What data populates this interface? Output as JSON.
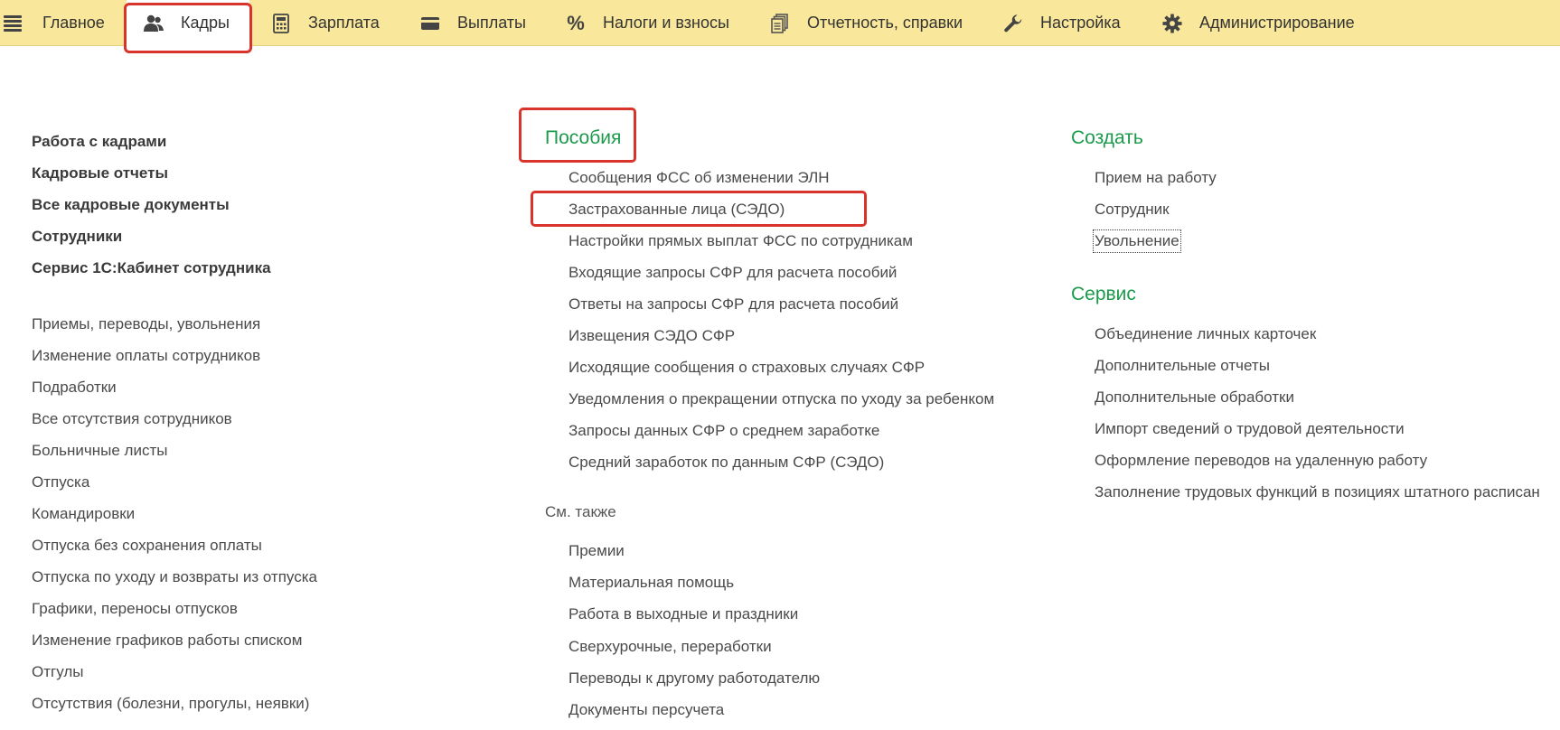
{
  "topbar": {
    "tabs": [
      {
        "label": "Главное",
        "icon": "none"
      },
      {
        "label": "Кадры",
        "icon": "people-icon"
      },
      {
        "label": "Зарплата",
        "icon": "calculator-icon"
      },
      {
        "label": "Выплаты",
        "icon": "wallet-icon"
      },
      {
        "label": "Налоги и взносы",
        "icon": "percent-icon"
      },
      {
        "label": "Отчетность, справки",
        "icon": "documents-icon"
      },
      {
        "label": "Настройка",
        "icon": "wrench-icon"
      },
      {
        "label": "Администрирование",
        "icon": "gear-icon"
      }
    ],
    "percent_glyph": "%",
    "active_tab": "Кадры",
    "accent_color": "#f9e79b"
  },
  "left": {
    "bold_items": [
      "Работа с кадрами",
      "Кадровые отчеты",
      "Все кадровые документы",
      "Сотрудники",
      "Сервис 1С:Кабинет сотрудника"
    ],
    "items": [
      "Приемы, переводы, увольнения",
      "Изменение оплаты сотрудников",
      "Подработки",
      "Все отсутствия сотрудников",
      "Больничные листы",
      "Отпуска",
      "Командировки",
      "Отпуска без сохранения оплаты",
      "Отпуска по уходу и возвраты из отпуска",
      "Графики, переносы отпусков",
      "Изменение графиков работы списком",
      "Отгулы",
      "Отсутствия (болезни, прогулы, неявки)"
    ]
  },
  "middle": {
    "title": "Пособия",
    "items": [
      "Сообщения ФСС об изменении ЭЛН",
      "Застрахованные лица (СЭДО)",
      "Настройки прямых выплат ФСС по сотрудникам",
      "Входящие запросы СФР для расчета пособий",
      "Ответы на запросы СФР для расчета пособий",
      "Извещения СЭДО СФР",
      "Исходящие сообщения о страховых случаях СФР",
      "Уведомления о прекращении отпуска по уходу за ребенком",
      "Запросы данных СФР о среднем заработке",
      "Средний заработок по данным СФР (СЭДО)"
    ],
    "see_also_label": "См. также",
    "see_also_items": [
      "Премии",
      "Материальная помощь",
      "Работа в выходные и праздники",
      "Сверхурочные, переработки",
      "Переводы к другому работодателю",
      "Документы персучета"
    ]
  },
  "right": {
    "create_title": "Создать",
    "create_items": [
      "Прием на работу",
      "Сотрудник",
      "Увольнение"
    ],
    "service_title": "Сервис",
    "service_items": [
      "Объединение личных карточек",
      "Дополнительные отчеты",
      "Дополнительные обработки",
      "Импорт сведений о трудовой деятельности",
      "Оформление переводов на удаленную работу",
      "Заполнение трудовых функций в позициях штатного расписан"
    ]
  }
}
